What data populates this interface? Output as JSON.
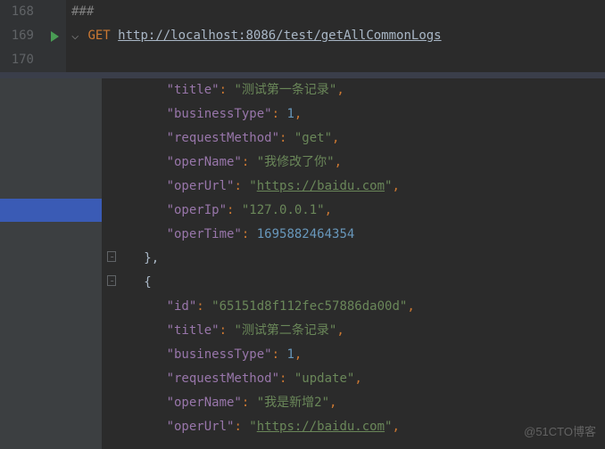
{
  "request": {
    "lines": [
      {
        "num": "168",
        "comment": "###"
      },
      {
        "num": "169",
        "method": "GET",
        "url": "http://localhost:8086/test/getAllCommonLogs",
        "run": true
      },
      {
        "num": "170"
      }
    ]
  },
  "response": {
    "obj1": {
      "title_k": "\"title\"",
      "title_v": "\"测试第一条记录\"",
      "bt_k": "\"businessType\"",
      "bt_v": "1",
      "rm_k": "\"requestMethod\"",
      "rm_v": "\"get\"",
      "on_k": "\"operName\"",
      "on_v": "\"我修改了你\"",
      "ou_k": "\"operUrl\"",
      "ou_pre": "\"",
      "ou_link": "https://baidu.com",
      "ou_post": "\"",
      "oi_k": "\"operIp\"",
      "oi_v": "\"127.0.0.1\"",
      "ot_k": "\"operTime\"",
      "ot_v": "1695882464354"
    },
    "close1": "},",
    "open2": "{",
    "obj2": {
      "id_k": "\"id\"",
      "id_v": "\"65151d8f112fec57886da00d\"",
      "title_k": "\"title\"",
      "title_v": "\"测试第二条记录\"",
      "bt_k": "\"businessType\"",
      "bt_v": "1",
      "rm_k": "\"requestMethod\"",
      "rm_v": "\"update\"",
      "on_k": "\"operName\"",
      "on_v": "\"我是新增2\"",
      "ou_k": "\"operUrl\"",
      "ou_pre": "\"",
      "ou_link": "https://baidu.com",
      "ou_post": "\""
    }
  },
  "punct": {
    "colon": ": ",
    "comma": ","
  },
  "watermark": "@51CTO博客"
}
